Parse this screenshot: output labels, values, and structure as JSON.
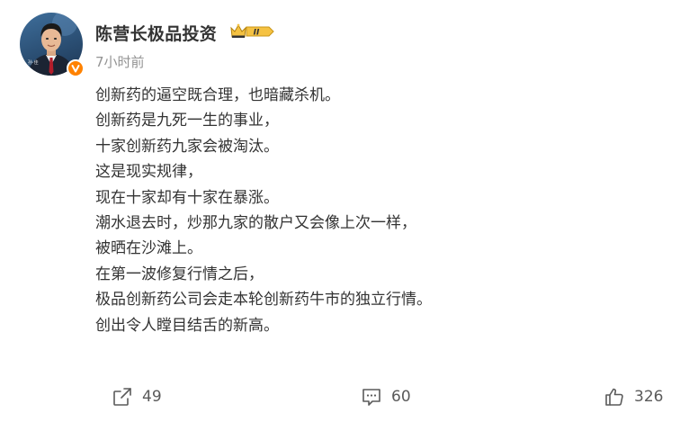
{
  "post": {
    "author": "陈营长极品投资",
    "timestamp": "7小时前",
    "level_badge": "II",
    "avatar_caption": "孙·佳",
    "content_lines": [
      "创新药的逼空既合理，也暗藏杀机。",
      "创新药是九死一生的事业，",
      "十家创新药九家会被淘汰。",
      "这是现实规律，",
      "现在十家却有十家在暴涨。",
      "潮水退去时，炒那九家的散户又会像上次一样，",
      "被晒在沙滩上。",
      "在第一波修复行情之后，",
      "极品创新药公司会走本轮创新药牛市的独立行情。",
      "创出令人瞠目结舌的新高。"
    ]
  },
  "actions": {
    "repost_count": "49",
    "comment_count": "60",
    "like_count": "326"
  },
  "icons": {
    "repost": "repost-icon",
    "comment": "comment-icon",
    "like": "thumbs-up-icon",
    "verified": "verified-v-icon",
    "crown": "crown-icon"
  },
  "colors": {
    "verified_orange": "#ff8200",
    "level_badge_gold": "#f5c242",
    "text_primary": "#333333",
    "text_secondary": "#939393"
  }
}
